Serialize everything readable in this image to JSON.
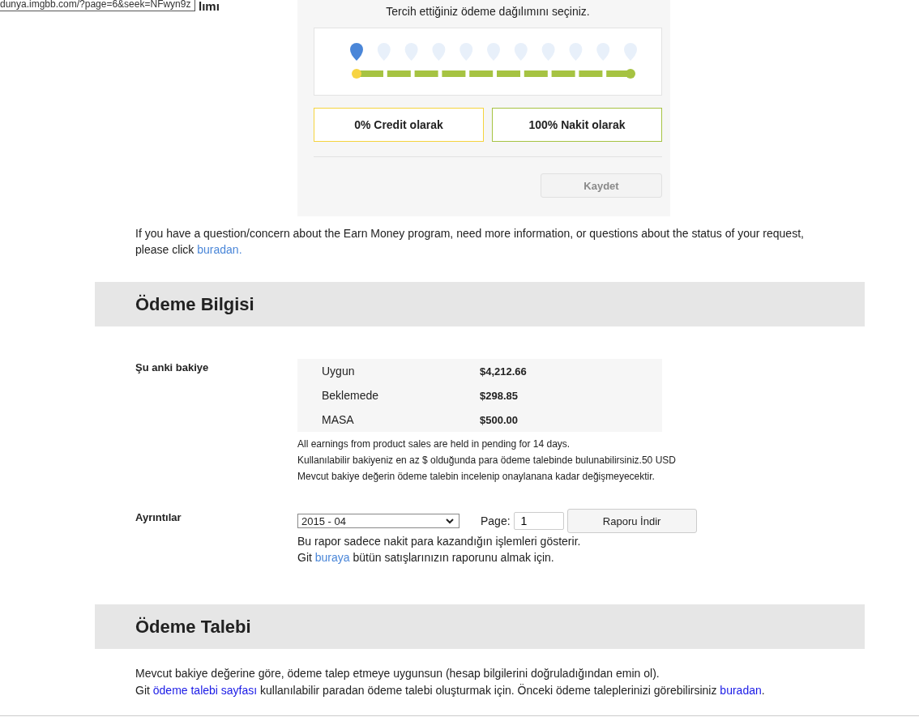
{
  "status_url": "dunya.imgbb.com/?page=6&seek=NFwyn9z",
  "cut_heading": "lımı",
  "distribution": {
    "prompt": "Tercih ettiğiniz ödeme dağılımını seçiniz.",
    "slider": {
      "level": 0
    },
    "credit": "0% Credit olarak",
    "cash": "100% Nakit olarak",
    "save": {
      "label": "Kaydet",
      "disabled": true
    }
  },
  "help": {
    "text": "If you have a question/concern about the Earn Money program, need more information, or questions about the status of your request, please click ",
    "link": "buradan."
  },
  "payment_info": {
    "title": "Ödeme Bilgisi",
    "balance_label": "Şu anki bakiye",
    "balances": [
      {
        "name": "Uygun",
        "amount": "$4,212.66"
      },
      {
        "name": "Beklemede",
        "amount": "$298.85"
      },
      {
        "name": "MASA",
        "amount": "$500.00"
      }
    ],
    "notes": [
      "All earnings from product sales are held in pending for 14 days.",
      "Kullanılabilir bakiyeniz en az $ olduğunda para ödeme talebinde bulunabilirsiniz.50 USD",
      "Mevcut bakiye değerin ödeme talebin incelenip onaylanana kadar değişmeyecektir."
    ],
    "details_label": "Ayrıntılar",
    "month": "2015 - 04",
    "page_label": "Page:",
    "page": "1",
    "download": "Raporu İndir",
    "report_note": "Bu rapor sadece nakit para kazandığın işlemleri gösterir.",
    "report_link": {
      "before": "Git ",
      "link": "buraya",
      "after": " bütün satışlarınızın raporunu almak için."
    }
  },
  "payment_request": {
    "title": "Ödeme Talebi",
    "text": "Mevcut bakiye değerine göre, ödeme talep etmeye uygunsun (hesap bilgilerini doğruladığından emin ol).",
    "line2": {
      "before": "Git ",
      "link": "ödeme talebi sayfası",
      "middle": " kullanılabilir paradan ödeme talebi oluşturmak için. Önceki ödeme taleplerinizi görebilirsiniz ",
      "link2": "buradan",
      "after": "."
    }
  }
}
